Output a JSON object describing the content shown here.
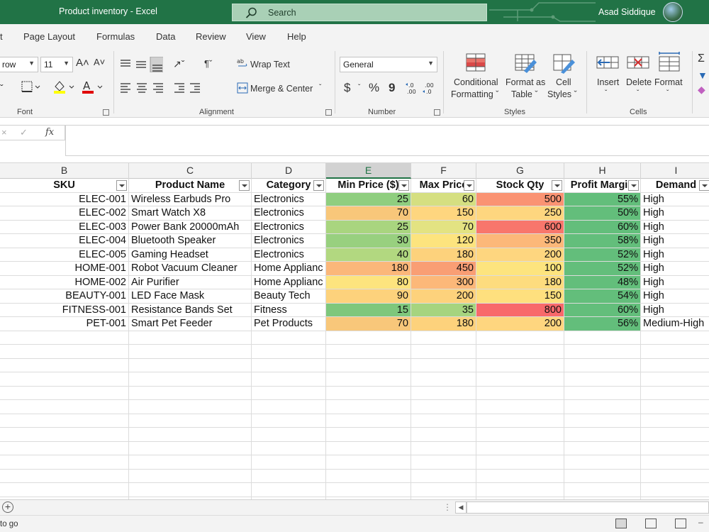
{
  "window": {
    "title": "Product inventory  -  Excel",
    "search_placeholder": "Search",
    "user_name": "Asad Siddique"
  },
  "menu": [
    "Page Layout",
    "Formulas",
    "Data",
    "Review",
    "View",
    "Help"
  ],
  "ribbon": {
    "font": {
      "font_name": "row",
      "font_size": "11",
      "grow_icon": "A˄",
      "shrink_icon": "A˅",
      "label": "Font"
    },
    "alignment": {
      "wrap_text": "Wrap Text",
      "merge_center": "Merge & Center",
      "label": "Alignment"
    },
    "number": {
      "format": "General",
      "currency_symbol": "$",
      "percent_symbol": "%",
      "comma_symbol": "9",
      "label": "Number"
    },
    "styles": {
      "conditional": [
        "Conditional",
        "Formatting"
      ],
      "format_as_table": [
        "Format as",
        "Table"
      ],
      "cell_styles": [
        "Cell",
        "Styles"
      ],
      "label": "Styles"
    },
    "cells": {
      "insert": "Insert",
      "delete": "Delete",
      "format": "Format",
      "label": "Cells"
    }
  },
  "formula_bar": {
    "fx": "fx",
    "content": ""
  },
  "grid": {
    "columns": [
      "B",
      "C",
      "D",
      "E",
      "F",
      "G",
      "H",
      "I"
    ],
    "selected_column": "E",
    "headers": [
      "SKU",
      "Product Name",
      "Category",
      "Min Price ($)",
      "Max Price",
      "Stock Qty",
      "Profit Margin",
      "Demand"
    ],
    "rows": [
      [
        "ELEC-001",
        "Wireless Earbuds Pro",
        "Electronics",
        "25",
        "60",
        "500",
        "55%",
        "High"
      ],
      [
        "ELEC-002",
        "Smart Watch X8",
        "Electronics",
        "70",
        "150",
        "250",
        "50%",
        "High"
      ],
      [
        "ELEC-003",
        "Power Bank 20000mAh",
        "Electronics",
        "25",
        "70",
        "600",
        "60%",
        "High"
      ],
      [
        "ELEC-004",
        "Bluetooth Speaker",
        "Electronics",
        "30",
        "120",
        "350",
        "58%",
        "High"
      ],
      [
        "ELEC-005",
        "Gaming Headset",
        "Electronics",
        "40",
        "180",
        "200",
        "52%",
        "High"
      ],
      [
        "HOME-001",
        "Robot Vacuum Cleaner",
        "Home Applianc",
        "180",
        "450",
        "100",
        "52%",
        "High"
      ],
      [
        "HOME-002",
        "Air Purifier",
        "Home Applianc",
        "80",
        "300",
        "180",
        "48%",
        "High"
      ],
      [
        "BEAUTY-001",
        "LED Face Mask",
        "Beauty Tech",
        "90",
        "200",
        "150",
        "54%",
        "High"
      ],
      [
        "FITNESS-001",
        "Resistance Bands Set",
        "Fitness",
        "15",
        "35",
        "800",
        "60%",
        "High"
      ],
      [
        "PET-001",
        "Smart Pet Feeder",
        "Pet Products",
        "70",
        "180",
        "200",
        "56%",
        "Medium-High"
      ]
    ],
    "color_scale": {
      "min_price": [
        "#8fce7f",
        "#f8c77a",
        "#a9d57f",
        "#98d07f",
        "#b2d880",
        "#fbb77a",
        "#fde47e",
        "#fdd27c",
        "#7ec77c",
        "#f8c77a"
      ],
      "max_price": [
        "#d5df81",
        "#fed67f",
        "#e3e382",
        "#fde47e",
        "#fdd27c",
        "#f99e74",
        "#fcb879",
        "#fdd27c",
        "#a6d47f",
        "#fdd27c"
      ],
      "stock_qty": [
        "#fa9373",
        "#fed67f",
        "#f8766c",
        "#fcb879",
        "#fed67f",
        "#fde47e",
        "#fddc7e",
        "#fee07e",
        "#f8696b",
        "#fed67f"
      ],
      "profit_margin": "#63be7b"
    }
  },
  "status": {
    "ready_text": "to go"
  }
}
